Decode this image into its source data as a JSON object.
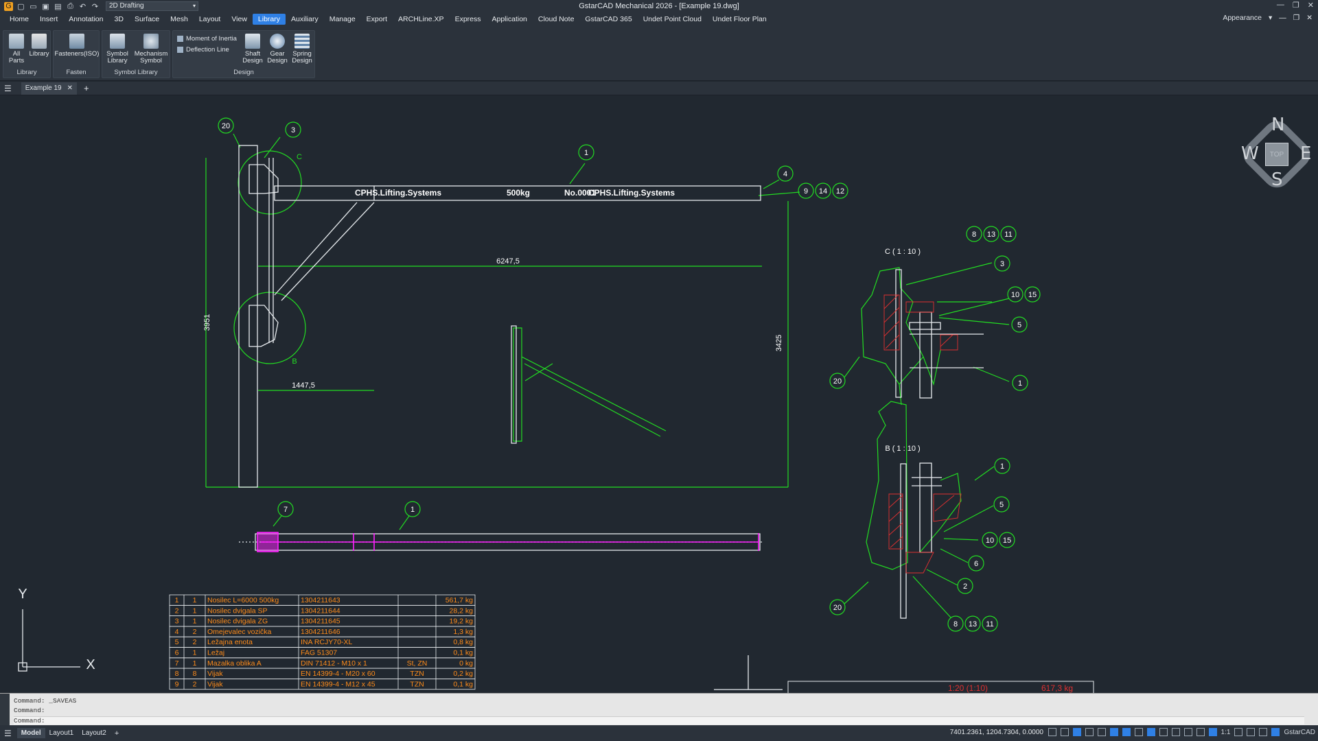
{
  "window": {
    "title": "GstarCAD Mechanical 2026 - [Example 19.dwg]",
    "workspace": "2D Drafting"
  },
  "menu": [
    "Home",
    "Insert",
    "Annotation",
    "3D",
    "Surface",
    "Mesh",
    "Layout",
    "View",
    "Library",
    "Auxiliary",
    "Manage",
    "Export",
    "ARCHLine.XP",
    "Express",
    "Application",
    "Cloud Note",
    "GstarCAD 365",
    "Undet Point Cloud",
    "Undet Floor Plan"
  ],
  "menu_active": "Library",
  "appearance": "Appearance",
  "ribbon": {
    "library": {
      "title": "Library",
      "all_parts": "All Parts",
      "library": "Library"
    },
    "fasten": {
      "title": "Fasten",
      "fasteners": "Fasteners(ISO)"
    },
    "symbol": {
      "title": "Symbol Library",
      "symbol_library": "Symbol Library",
      "mechanism": "Mechanism Symbol"
    },
    "design": {
      "title": "Design",
      "moment": "Moment of Inertia",
      "deflection": "Deflection Line",
      "shaft": "Shaft Design",
      "gear": "Gear Design",
      "spring": "Spring Design"
    }
  },
  "doc_tab": "Example 19",
  "drawing": {
    "beam_texts": [
      "CPHS.Lifting.Systems",
      "500kg",
      "No.0001",
      "CPHS.Lifting.Systems"
    ],
    "dims": {
      "d1": "6247,5",
      "d2": "1447,5",
      "d3": "3951",
      "d4": "3425"
    },
    "detail_labels": {
      "c": "C",
      "b": "B",
      "c_title": "C ( 1 : 10 )",
      "b_title": "B ( 1 : 10 )"
    },
    "balloons": {
      "b20a": "20",
      "b3a": "3",
      "b1a": "1",
      "b4": "4",
      "b9": "9",
      "b14": "14",
      "b12": "12",
      "b7": "7",
      "b1b": "1",
      "c8": "8",
      "c13": "13",
      "c11": "11",
      "c3": "3",
      "c10": "10",
      "c15": "15",
      "c5": "5",
      "c20": "20",
      "c1": "1",
      "bb1": "1",
      "bb5": "5",
      "bb10": "10",
      "bb15": "15",
      "bb6": "6",
      "bb2": "2",
      "bb20": "20",
      "bb8": "8",
      "bb13": "13",
      "bb11": "11"
    },
    "ucs": {
      "y": "Y",
      "x": "X"
    },
    "bom": [
      [
        "1",
        "1",
        "Nosilec L=6000 500kg",
        "1304211643",
        "",
        "561,7 kg"
      ],
      [
        "2",
        "1",
        "Nosilec dvigala SP",
        "1304211644",
        "",
        "28,2 kg"
      ],
      [
        "3",
        "1",
        "Nosilec dvigala ZG",
        "1304211645",
        "",
        "19,2 kg"
      ],
      [
        "4",
        "2",
        "Omejevalec vozička",
        "1304211646",
        "",
        "1,3 kg"
      ],
      [
        "5",
        "2",
        "Ležajna enota",
        "INA RCJY70-XL",
        "",
        "0,8 kg"
      ],
      [
        "6",
        "1",
        "Ležaj",
        "FAG 51307",
        "",
        "0,1 kg"
      ],
      [
        "7",
        "1",
        "Mazalka oblika A",
        "DIN 71412 - M10 x 1",
        "St, ZN",
        "0 kg"
      ],
      [
        "8",
        "8",
        "Vijak",
        "EN 14399-4 - M20 x 60",
        "TZN",
        "0,2 kg"
      ],
      [
        "9",
        "2",
        "Vijak",
        "EN 14399-4 - M12 x 45",
        "TZN",
        "0,1 kg"
      ]
    ],
    "titleblock": {
      "scale": "1:20 (1:10)",
      "mass": "617,3 kg"
    },
    "compass": {
      "n": "N",
      "s": "S",
      "e": "E",
      "w": "W",
      "top": "TOP"
    }
  },
  "command": {
    "line1": "Command: _SAVEAS",
    "line2": "Command:",
    "line3": "Command:"
  },
  "status": {
    "model": "Model",
    "layout1": "Layout1",
    "layout2": "Layout2",
    "coords": "7401.2361, 1204.7304, 0.0000",
    "scale": "1:1",
    "brand": "GstarCAD"
  },
  "colors": {
    "accent": "#2f80e5",
    "green": "#22dd22",
    "magenta": "#ff00ff",
    "orange": "#ff8c1a",
    "red": "#e03030",
    "bg": "#212830"
  }
}
